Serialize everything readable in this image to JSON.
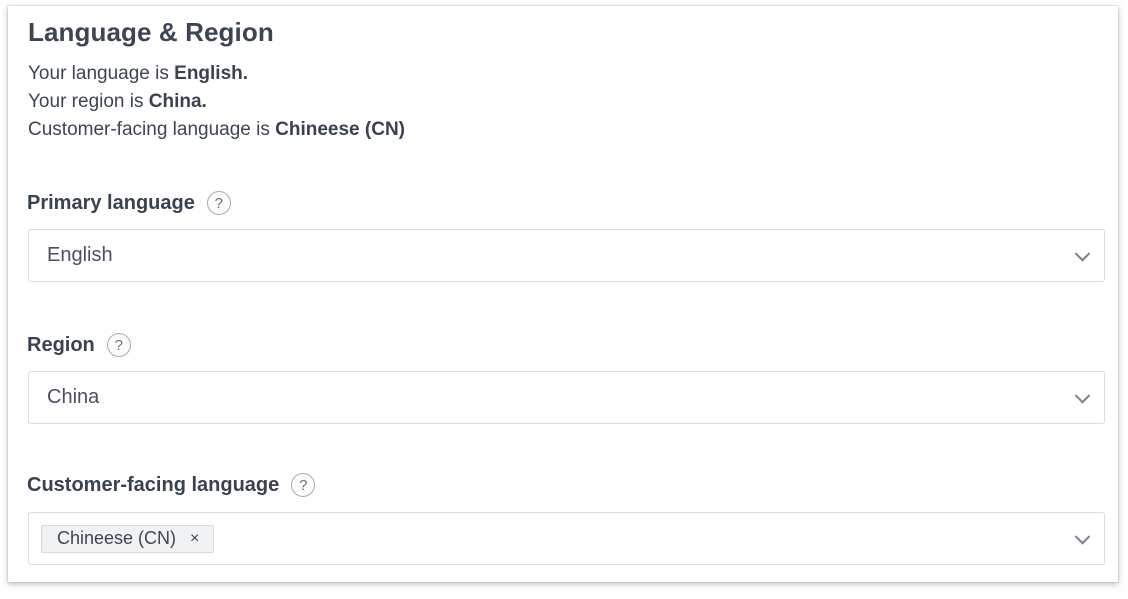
{
  "section": {
    "title": "Language & Region"
  },
  "summary": {
    "language_prefix": "Your language is ",
    "language_value": "English.",
    "region_prefix": "Your region is ",
    "region_value": "China.",
    "customer_prefix": "Customer-facing language is ",
    "customer_value": "Chineese (CN)"
  },
  "fields": {
    "primary_language": {
      "label": "Primary language",
      "help": "?",
      "value": "English"
    },
    "region": {
      "label": "Region",
      "help": "?",
      "value": "China"
    },
    "customer_language": {
      "label": "Customer-facing language",
      "help": "?",
      "tags": [
        "Chineese (CN)"
      ],
      "remove_glyph": "×"
    }
  },
  "icons": {
    "help": "question-circle-icon",
    "dropdown": "chevron-down-icon",
    "remove": "close-icon"
  }
}
